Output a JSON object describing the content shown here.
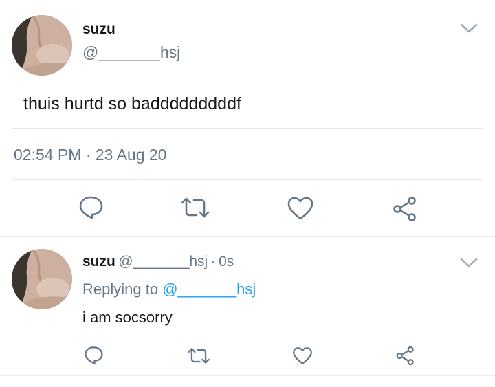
{
  "main_tweet": {
    "author_name": "suzu",
    "author_handle": "@_______hsj",
    "text": "thuis hurtd so badddddddddf",
    "timestamp": "02:54 PM · 23 Aug 20"
  },
  "reply_tweet": {
    "author_name": "suzu",
    "author_handle": "@_______hsj",
    "time_sep": "·",
    "time_ago": "0s",
    "replying_label": "Replying to",
    "replying_handle": "@_______hsj",
    "text": "i am socsorry"
  },
  "icons": {
    "reply": "reply-icon",
    "retweet": "retweet-icon",
    "like": "heart-icon",
    "share": "share-icon",
    "menu": "chevron-down-icon"
  },
  "colors": {
    "text": "#14171a",
    "secondary": "#657786",
    "link": "#1da1f2",
    "divider": "#e1e8ed"
  }
}
